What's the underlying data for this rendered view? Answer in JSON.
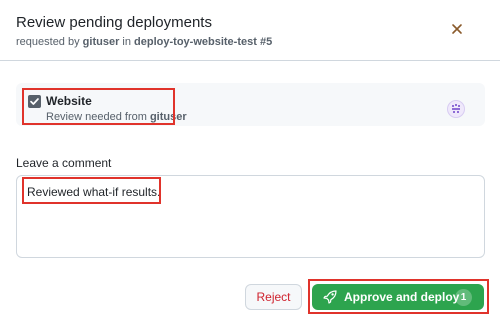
{
  "dialog": {
    "title": "Review pending deployments",
    "subtitle_prefix": "requested by",
    "requester": "gituser",
    "subtitle_middle": "in",
    "run": "deploy-toy-website-test #5"
  },
  "environment": {
    "name": "Website",
    "checked": true,
    "review_prefix": "Review needed from",
    "reviewer": "gituser"
  },
  "comment": {
    "label": "Leave a comment",
    "value": "Reviewed what-if results."
  },
  "actions": {
    "reject_label": "Reject",
    "approve_label": "Approve and deploy",
    "approve_count": "1"
  },
  "icons": {
    "close": "close-icon",
    "checkbox": "checkmark-icon",
    "avatar": "avatar-icon",
    "approve": "rocket-icon"
  },
  "colors": {
    "approve_bg": "#2da44e",
    "reject_text": "#cf222e",
    "highlight": "#e0332b"
  }
}
